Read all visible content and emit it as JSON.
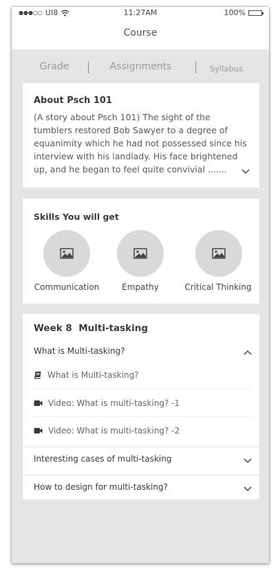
{
  "status_bar": {
    "carrier": "UI8",
    "signal_dots": "●●●○○",
    "time": "11:27AM",
    "battery": "100%"
  },
  "header": {
    "title": "Course"
  },
  "tabs": [
    {
      "label": "Grade"
    },
    {
      "label": "Assignments"
    },
    {
      "label": "Syllabus"
    }
  ],
  "about": {
    "title": "About Psch 101",
    "text": "(A story about Psch 101) The sight of the tumblers restored Bob Sawyer to a degree of equanimity which he had not possessed since his interview with his landlady. His face brightened up, and he began to feel quite convivial ......."
  },
  "skills": {
    "title": "Skills You will get",
    "items": [
      {
        "label": "Communication",
        "icon": "image-icon"
      },
      {
        "label": "Empathy",
        "icon": "image-icon"
      },
      {
        "label": "Critical Thinking",
        "icon": "image-icon"
      }
    ]
  },
  "week": {
    "title": "Week 8  Multi-tasking",
    "lessons": [
      {
        "title": "What is Multi-tasking?",
        "expanded": true,
        "items": [
          {
            "label": "What is Multi-tasking?",
            "icon": "book-icon"
          },
          {
            "label": "Video: What is multi-tasking? -1",
            "icon": "video-camera-icon"
          },
          {
            "label": "Video: What is multi-tasking? -2",
            "icon": "video-camera-icon"
          }
        ]
      },
      {
        "title": "Interesting cases of multi-tasking",
        "expanded": false
      },
      {
        "title": "How to design for multi-tasking?",
        "expanded": false
      }
    ]
  },
  "colors": {
    "background": "#e5e5e5",
    "card": "#ffffff",
    "icon_circle": "#d9d9d9",
    "text": "#3a3a3a"
  }
}
